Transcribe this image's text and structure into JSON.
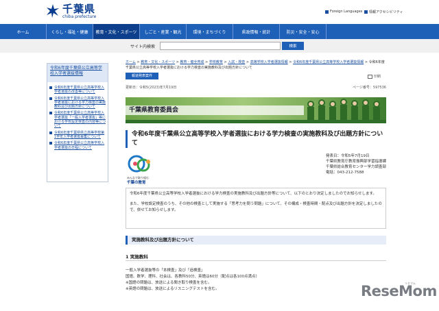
{
  "header": {
    "logo_jp": "千葉県",
    "logo_en": "chiba prefecture",
    "util": [
      "Foreign Languages",
      "情報アクセシビリティ"
    ]
  },
  "nav": [
    "ホーム",
    "くらし・福祉・健康",
    "教育・文化・スポーツ",
    "しごと・産業・観光",
    "環境・まちづくり",
    "県政情報・統計",
    "防災・安全・安心"
  ],
  "search": {
    "label": "サイト内検索",
    "button": "検索",
    "placeholder": ""
  },
  "sidebar": {
    "title": "令和6年度千葉県公立高等学校入学者選抜情報",
    "items": [
      "令和6年度千葉県公立高等学校入学者選抜の改善等について",
      "令和6年度千葉県公立高等学校入学者選抜における学力検査の実施教科及び出題方針について",
      "令和6年度千葉県公立高等学校入学者選抜「一般入学者選抜」等における学校設定検査の内容等について",
      "令和6年度千葉県県立高等学校第1学年入学者選抜募集について",
      "令和6年度千葉県公立高等学校入学者選抜の日程について"
    ]
  },
  "breadcrumb": {
    "items": [
      "ホーム",
      "教育・文化・スポーツ",
      "教育・健全育成",
      "学校教育",
      "入試・検査",
      "高等学校入学者選抜情報",
      "令和6年度千葉県公立高等学校入学者選抜情報"
    ],
    "current": "令和6年度千葉県公立高等学校入学者選抜における学力検査の実施教科及び出題方針について"
  },
  "press_badge": "報道発表案件",
  "updated": "更新日：令和5(2023)年7月19日",
  "page_id": "ページ番号：597536",
  "print_label": "印刷",
  "banner_title": "千葉県教育委員会",
  "page_title": "令和6年度千葉県公立高等学校入学者選抜における学力検査の実施教科及び出題方針について",
  "emblem": {
    "caption_small": "みんなで取り組む",
    "caption": "千葉の教育"
  },
  "meta": [
    "発表日：令和5年7月19日",
    "千葉県教育庁教育振興部学習指導課",
    "千葉県総合教育センター学力調査部",
    "電話：043-212-7588"
  ],
  "lead": [
    "令和6年度千葉県公立高等学校入学者選抜における学力検査の実施教科及び出題方針等について、以下のとおり決定しましたのでお知らせします。",
    "また、学校設定検査のうち、その他の検査として実施する「思考力を問う問題」について、その構成・検査時間・配点及び出題方針を決定しましたので、併せてお知らせします。"
  ],
  "section_heading": "実施教科及び出題方針について",
  "subsection_heading": "1 実施教科",
  "body_lines": [
    "一般入学者選抜等の「本検査」及び「追検査」",
    "国語、数学、理科、社会は、各教科50分、英語は60分（配点は各100点満点）",
    "※国語の問題は、放送による聞き取り検査を含む。",
    "※英語の問題は、放送によるリスニングテストを含む。"
  ],
  "watermark": "ReseMom",
  "watermark_small": "リセマム"
}
